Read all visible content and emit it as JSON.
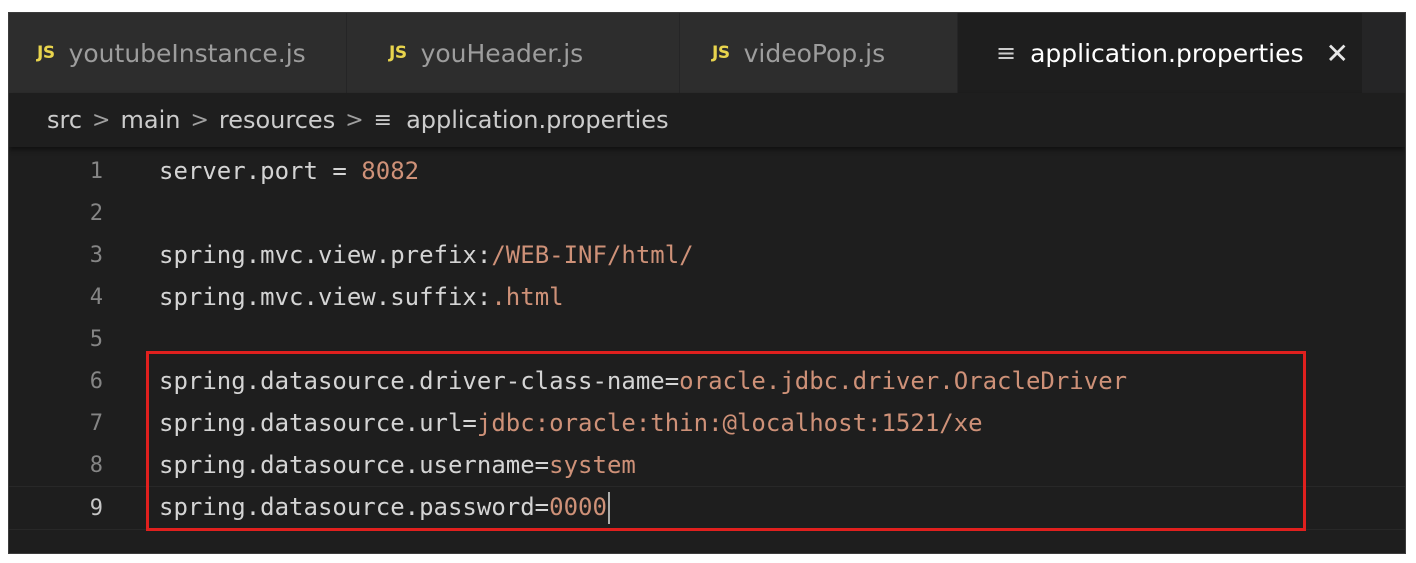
{
  "tabs": [
    {
      "label": "youtubeInstance.js",
      "badge": "JS",
      "active": false
    },
    {
      "label": "youHeader.js",
      "badge": "JS",
      "active": false
    },
    {
      "label": "videoPop.js",
      "badge": "JS",
      "active": false
    },
    {
      "label": "application.properties",
      "icon": "menu-lines-icon",
      "active": true
    }
  ],
  "breadcrumb": {
    "parts": [
      "src",
      "main",
      "resources",
      "application.properties"
    ],
    "separator": ">"
  },
  "code_lines": [
    {
      "number": "1",
      "key": "server.port = ",
      "value": "8082"
    },
    {
      "number": "2",
      "key": "",
      "value": ""
    },
    {
      "number": "3",
      "key": "spring.mvc.view.prefix:",
      "value": "/WEB-INF/html/"
    },
    {
      "number": "4",
      "key": "spring.mvc.view.suffix:",
      "value": ".html"
    },
    {
      "number": "5",
      "key": "",
      "value": ""
    },
    {
      "number": "6",
      "key": "spring.datasource.driver-class-name=",
      "value": "oracle.jdbc.driver.OracleDriver"
    },
    {
      "number": "7",
      "key": "spring.datasource.url=",
      "value": "jdbc:oracle:thin:@localhost:1521/xe"
    },
    {
      "number": "8",
      "key": "spring.datasource.username=",
      "value": "system"
    },
    {
      "number": "9",
      "key": "spring.datasource.password=",
      "value": "0000"
    }
  ],
  "colors": {
    "editor_bg": "#1e1e1e",
    "key_text": "#d4d4d4",
    "value_text": "#ce9178",
    "js_badge": "#e8d44d",
    "highlight_box": "#e0201e"
  }
}
